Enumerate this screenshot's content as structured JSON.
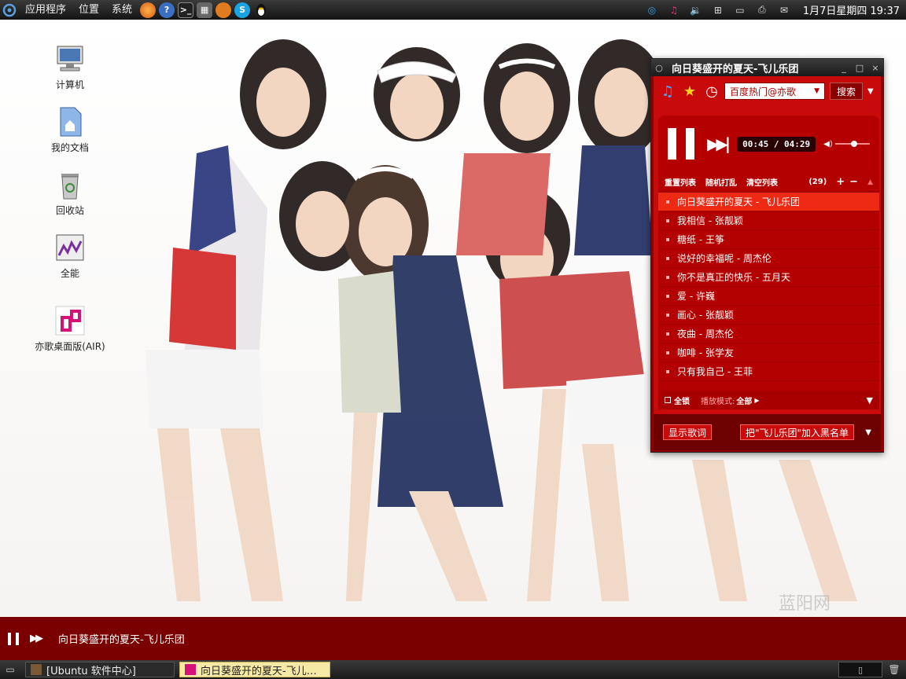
{
  "top_panel": {
    "menus": [
      "应用程序",
      "位置",
      "系统"
    ],
    "clock": "1月7日星期四 19:37"
  },
  "desktop_icons": [
    {
      "label": "计算机",
      "icon": "computer-icon"
    },
    {
      "label": "我的文档",
      "icon": "documents-icon"
    },
    {
      "label": "回收站",
      "icon": "trash-icon"
    },
    {
      "label": "全能",
      "icon": "monitor-app-icon"
    },
    {
      "label": "亦歌桌面版(AIR)",
      "icon": "yige-logo-icon"
    }
  ],
  "player": {
    "title": "向日葵盛开的夏天-飞儿乐团",
    "source": "百度热门@亦歌",
    "search_label": "搜索",
    "time": "00:45 / 04:29",
    "volume_level": 0.45,
    "list_controls": {
      "reset": "重置列表",
      "shuffle": "随机打乱",
      "clear": "清空列表",
      "count": "(29)"
    },
    "songs": [
      "向日葵盛开的夏天 - 飞儿乐团",
      "我相信 - 张靓颖",
      "糖纸 - 王筝",
      "说好的幸福呢 - 周杰伦",
      "你不是真正的快乐 - 五月天",
      "爱 - 许巍",
      "画心 - 张靓颖",
      "夜曲 - 周杰伦",
      "咖啡 - 张学友",
      "只有我自己 - 王菲"
    ],
    "active_index": 0,
    "footer": {
      "lock_label": "全锁",
      "mode_label": "播放模式:",
      "mode_value": "全部"
    },
    "lyrics_button": "显示歌词",
    "blacklist_button": "把\"飞儿乐团\"加入黑名单"
  },
  "now_playing_strip": {
    "title": "向日葵盛开的夏天-飞儿乐团"
  },
  "taskbar": {
    "tasks": [
      {
        "label": "[Ubuntu 软件中心]",
        "active": false
      },
      {
        "label": "向日葵盛开的夏天-飞儿…",
        "active": true
      }
    ]
  },
  "watermark": "蓝阳网",
  "colors": {
    "player_red": "#c80a0a",
    "player_dark": "#8e0000",
    "active_row": "#ef2a14",
    "panel_dark": "#1a1a1a"
  }
}
